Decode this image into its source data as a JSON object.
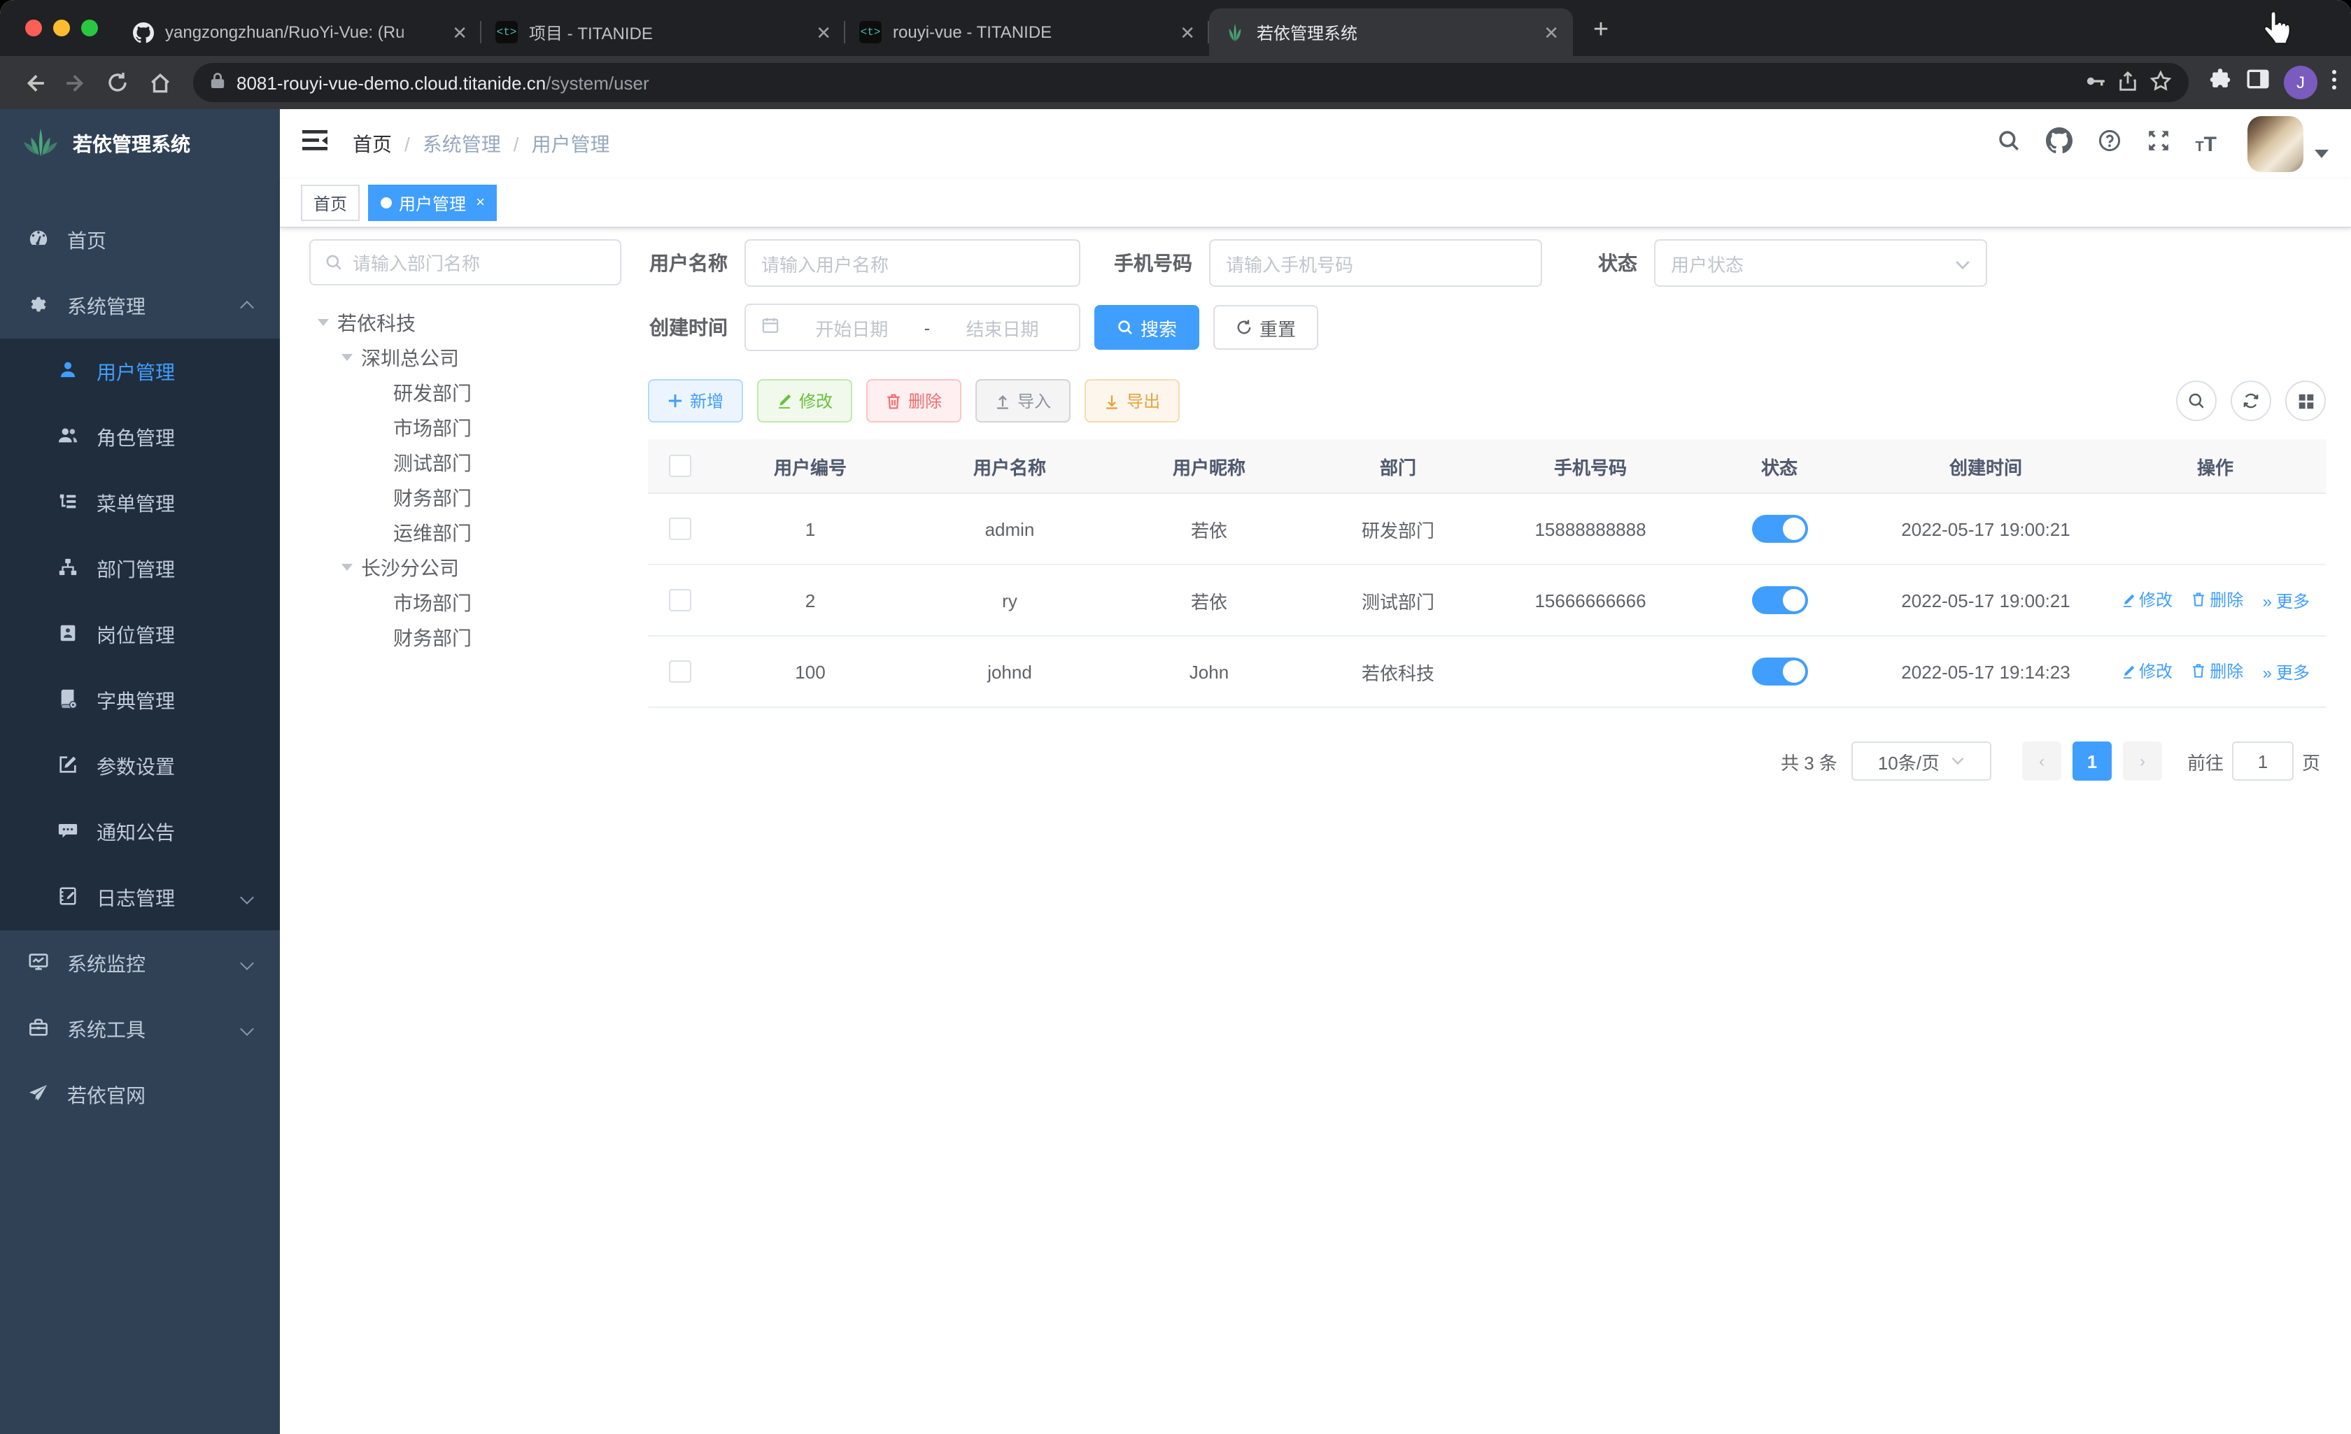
{
  "browser": {
    "tabs": [
      {
        "title": "yangzongzhuan/RuoYi-Vue: (Ru"
      },
      {
        "title": "项目 - TITANIDE",
        "favicon_text": "<t>"
      },
      {
        "title": "rouyi-vue - TITANIDE",
        "favicon_text": "<t>"
      },
      {
        "title": "若依管理系统"
      }
    ],
    "close_glyph": "✕",
    "new_tab_glyph": "+",
    "url": {
      "host": "8081-rouyi-vue-demo.cloud.titanide.cn",
      "path": "/system/user"
    },
    "profile_initial": "J"
  },
  "app": {
    "logo_title": "若依管理系统",
    "menu": {
      "home": "首页",
      "system": "系统管理",
      "user": "用户管理",
      "role": "角色管理",
      "menu": "菜单管理",
      "dept": "部门管理",
      "post": "岗位管理",
      "dict": "字典管理",
      "config": "参数设置",
      "notice": "通知公告",
      "log": "日志管理",
      "monitor": "系统监控",
      "tool": "系统工具",
      "site": "若依官网"
    },
    "breadcrumb": {
      "home": "首页",
      "sep": "/",
      "system": "系统管理",
      "user": "用户管理"
    },
    "tags": {
      "home": "首页",
      "current": "用户管理",
      "close": "×"
    }
  },
  "dept_panel": {
    "search_placeholder": "请输入部门名称",
    "tree": [
      "若依科技",
      "深圳总公司",
      "研发部门",
      "市场部门",
      "测试部门",
      "财务部门",
      "运维部门",
      "长沙分公司",
      "市场部门",
      "财务部门"
    ]
  },
  "filters": {
    "username_label": "用户名称",
    "username_placeholder": "请输入用户名称",
    "phone_label": "手机号码",
    "phone_placeholder": "请输入手机号码",
    "status_label": "状态",
    "status_placeholder": "用户状态",
    "created_label": "创建时间",
    "date_start": "开始日期",
    "date_sep": "-",
    "date_end": "结束日期",
    "search_button": "搜索",
    "reset_button": "重置"
  },
  "toolbar": {
    "add": "新增",
    "edit": "修改",
    "delete": "删除",
    "import": "导入",
    "export": "导出"
  },
  "table": {
    "columns": [
      "用户编号",
      "用户名称",
      "用户昵称",
      "部门",
      "手机号码",
      "状态",
      "创建时间",
      "操作"
    ],
    "rows": [
      {
        "id": "1",
        "username": "admin",
        "nickname": "若依",
        "dept": "研发部门",
        "phone": "15888888888",
        "created": "2022-05-17 19:00:21"
      },
      {
        "id": "2",
        "username": "ry",
        "nickname": "若依",
        "dept": "测试部门",
        "phone": "15666666666",
        "created": "2022-05-17 19:00:21"
      },
      {
        "id": "100",
        "username": "johnd",
        "nickname": "John",
        "dept": "若依科技",
        "phone": "",
        "created": "2022-05-17 19:14:23"
      }
    ],
    "actions": {
      "edit": "修改",
      "delete": "删除",
      "more": "更多",
      "more_glyph": "»"
    }
  },
  "pagination": {
    "total": "共 3 条",
    "page_size": "10条/页",
    "prev": "‹",
    "next": "›",
    "current_page": "1",
    "goto_label": "前往",
    "goto_value": "1",
    "page_suffix": "页"
  },
  "colors": {
    "accent": "#409eff",
    "sidebar_bg": "#304156",
    "submenu_bg": "#1f2d3d",
    "logo_green": "#4dab7c"
  }
}
